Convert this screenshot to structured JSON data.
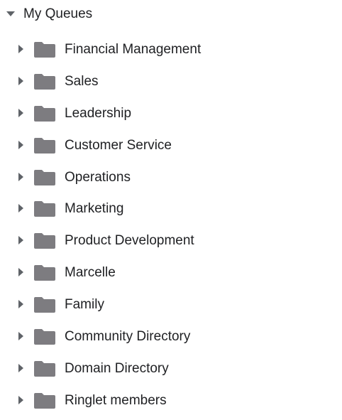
{
  "tree": {
    "root_label": "My Queues",
    "folder_color": "#7d7c80",
    "items": [
      {
        "label": "Financial Management"
      },
      {
        "label": "Sales"
      },
      {
        "label": "Leadership"
      },
      {
        "label": "Customer Service"
      },
      {
        "label": "Operations"
      },
      {
        "label": "Marketing"
      },
      {
        "label": "Product Development"
      },
      {
        "label": "Marcelle"
      },
      {
        "label": "Family"
      },
      {
        "label": "Community Directory"
      },
      {
        "label": "Domain Directory"
      },
      {
        "label": "Ringlet members"
      }
    ]
  }
}
